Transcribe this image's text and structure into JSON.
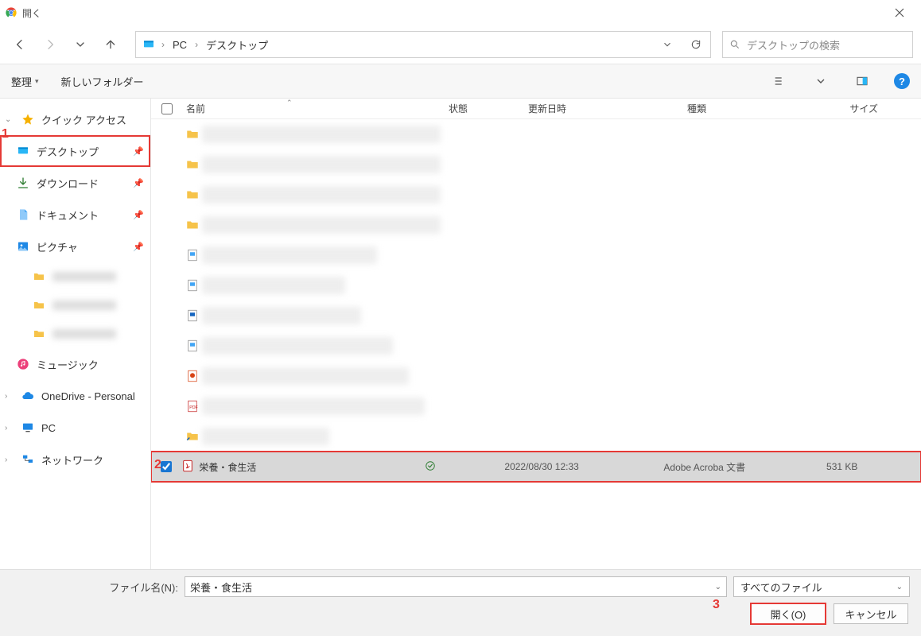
{
  "window": {
    "title": "開く"
  },
  "breadcrumb": {
    "root": "PC",
    "current": "デスクトップ"
  },
  "search": {
    "placeholder": "デスクトップの検索"
  },
  "toolbar": {
    "organize": "整理",
    "new_folder": "新しいフォルダー"
  },
  "sidebar": {
    "quick_access": "クイック アクセス",
    "desktop": "デスクトップ",
    "downloads": "ダウンロード",
    "documents": "ドキュメント",
    "pictures": "ピクチャ",
    "music": "ミュージック",
    "onedrive": "OneDrive - Personal",
    "pc": "PC",
    "network": "ネットワーク"
  },
  "columns": {
    "name": "名前",
    "status": "状態",
    "modified": "更新日時",
    "type": "種類",
    "size": "サイズ"
  },
  "selected_row": {
    "name": "栄養・食生活",
    "modified": "2022/08/30 12:33",
    "type": "Adobe Acroba 文書",
    "size": "531 KB"
  },
  "footer": {
    "filename_label": "ファイル名(N):",
    "filename_value": "栄養・食生活",
    "filter": "すべてのファイル",
    "open": "開く(O)",
    "cancel": "キャンセル"
  },
  "annotations": {
    "one": "1",
    "two": "2",
    "three": "3"
  }
}
